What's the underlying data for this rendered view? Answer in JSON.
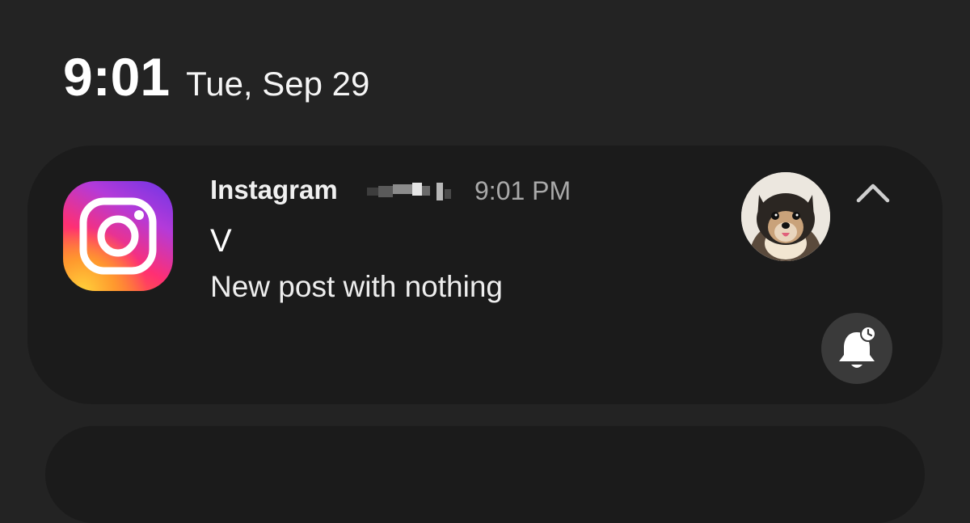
{
  "status": {
    "time": "9:01",
    "date": "Tue, Sep 29"
  },
  "notification": {
    "app_name": "Instagram",
    "account": "(blurred username)",
    "time": "9:01 PM",
    "title": "V",
    "body": "New post with nothing",
    "app_icon": "instagram-icon",
    "avatar_icon": "dog-avatar",
    "expand_icon": "chevron-up-icon",
    "snooze_icon": "bell-snooze-icon"
  },
  "colors": {
    "background": "#232323",
    "card": "#1b1b1b",
    "secondary_text": "#a9a9a9",
    "snooze_button": "#3a3a3a"
  }
}
